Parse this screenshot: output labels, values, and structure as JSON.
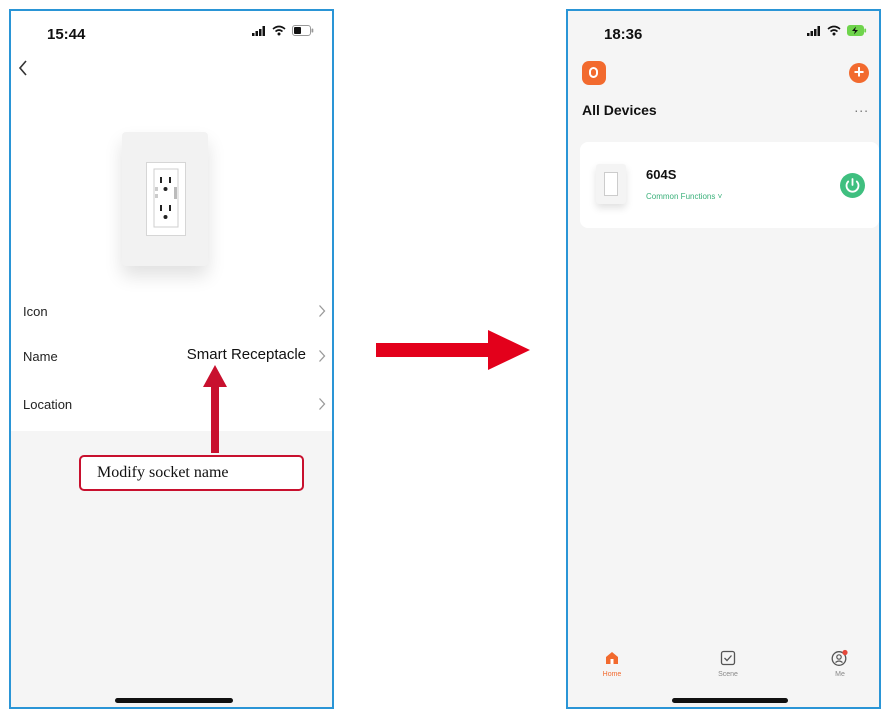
{
  "left_phone": {
    "status_time": "15:44",
    "rows": [
      {
        "label": "Icon",
        "value": ""
      },
      {
        "label": "Name",
        "value": "Smart Receptacle"
      },
      {
        "label": "Location",
        "value": ""
      }
    ],
    "callout_text": "Modify socket name"
  },
  "right_phone": {
    "status_time": "18:36",
    "section_title": "All Devices",
    "more_label": "...",
    "device": {
      "name": "604S",
      "functions": "Common Functions ˅"
    },
    "tabs": [
      {
        "label": "Home",
        "icon": "home-icon",
        "active": true
      },
      {
        "label": "Scene",
        "icon": "scene-check-icon",
        "active": false
      },
      {
        "label": "Me",
        "icon": "profile-icon",
        "active": false
      }
    ]
  },
  "colors": {
    "frame_border": "#2a95d6",
    "annotation_red": "#c8102e",
    "arrow_red": "#e3001b",
    "accent_orange": "#f26a2e",
    "power_green": "#3fbf7f"
  }
}
